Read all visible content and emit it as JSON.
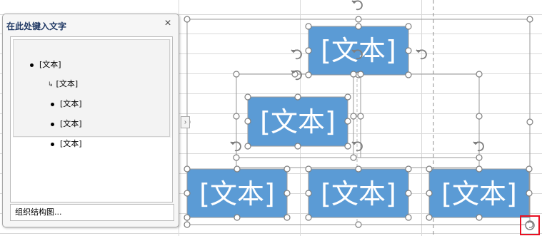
{
  "text_pane": {
    "title": "在此处键入文字",
    "close_glyph": "×",
    "items": [
      {
        "text": "[文本]",
        "style": "bullet"
      },
      {
        "text": "[文本]",
        "style": "arrow"
      },
      {
        "text": "[文本]",
        "style": "bullet"
      },
      {
        "text": "[文本]",
        "style": "bullet"
      },
      {
        "text": "[文本]",
        "style": "bullet"
      }
    ],
    "footer_link": "组织结构图...",
    "toggle_glyph": "›"
  },
  "smartart": {
    "node_label": "[文本]",
    "nodes": [
      {
        "name": "top-node",
        "label": "[文本]"
      },
      {
        "name": "assistant-node",
        "label": "[文本]"
      },
      {
        "name": "child-node-1",
        "label": "[文本]"
      },
      {
        "name": "child-node-2",
        "label": "[文本]"
      },
      {
        "name": "child-node-3",
        "label": "[文本]"
      }
    ],
    "colors": {
      "node_fill": "#5b9bd5",
      "node_text": "#ffffff",
      "handle": "#ffffff",
      "handle_border": "#7f7f7f",
      "highlight": "#e81123"
    }
  }
}
